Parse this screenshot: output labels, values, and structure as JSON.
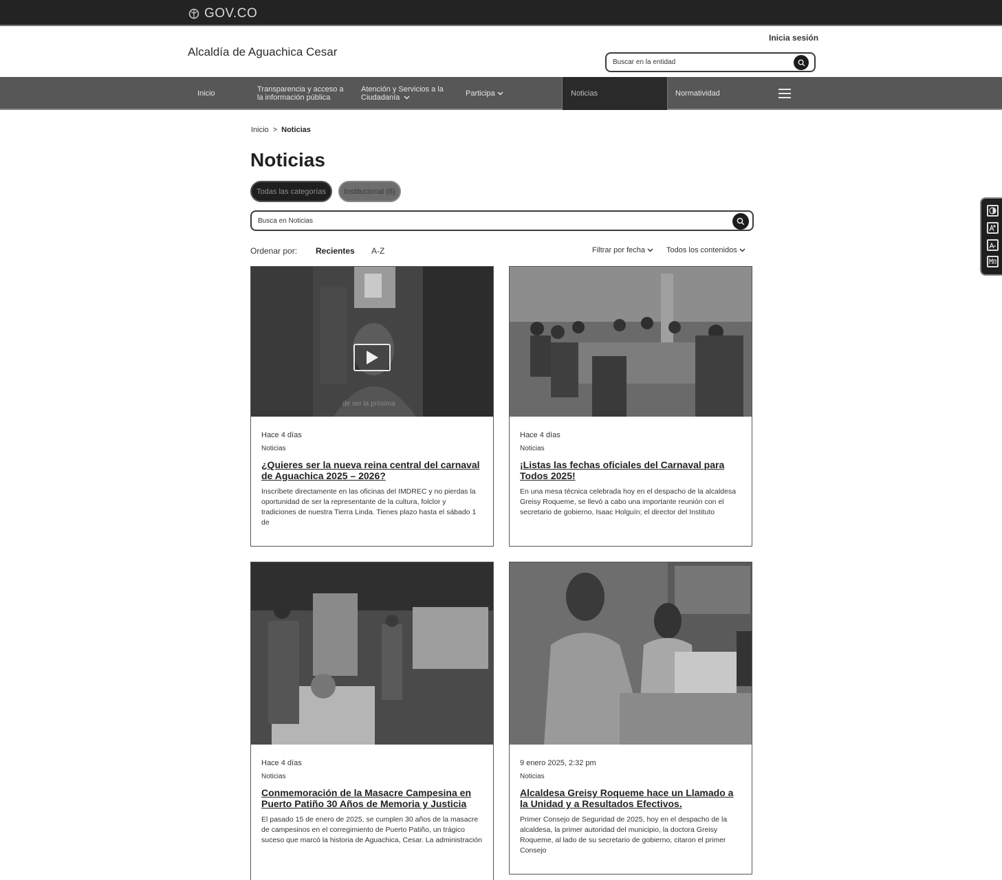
{
  "govbar": {
    "logo_text": "GOV.CO"
  },
  "header": {
    "entity_title": "Alcaldía de Aguachica Cesar",
    "login_label": "Inicia sesión",
    "search_placeholder": "Buscar en la entidad"
  },
  "nav": {
    "items": [
      {
        "label": "Inicio"
      },
      {
        "label": "Transparencia y acceso a la información pública"
      },
      {
        "label": "Atención y Servicios a la Ciudadanía"
      },
      {
        "label": "Participa"
      },
      {
        "label": "Noticias",
        "active": true
      },
      {
        "label": "Normatividad"
      }
    ]
  },
  "breadcrumb": {
    "home": "Inicio",
    "separator": ">",
    "current": "Noticias"
  },
  "page_title": "Noticias",
  "filters": {
    "chips": [
      {
        "label": "Todas las categorías"
      },
      {
        "label": "Institucional (6)"
      }
    ],
    "search_placeholder": "Busca en Noticias",
    "sort_label": "Ordenar por:",
    "sort_options": [
      "Recientes",
      "A-Z"
    ],
    "date_filter": "Filtrar por fecha",
    "content_filter": "Todos los contenidos"
  },
  "cards": [
    {
      "date": "Hace 4 días",
      "category": "Noticias",
      "title": "¿Quieres ser la nueva reina central del carnaval de Aguachica 2025 – 2026?",
      "excerpt": "Inscríbete directamente en las oficinas del IMDREC y no pierdas la oportunidad de ser la representante de la cultura, folclor y tradiciones de nuestra Tierra Linda. Tienes plazo hasta el sábado 1 de",
      "image_overlay_text": "de ser la próxima",
      "has_video": true
    },
    {
      "date": "Hace 4 días",
      "category": "Noticias",
      "title": "¡Listas las fechas oficiales del Carnaval para Todos 2025!",
      "excerpt": "En una mesa técnica celebrada hoy en el despacho de la alcaldesa Greisy Roqueme, se llevó a cabo una importante reunión con el secretario de gobierno, Isaac Holguín; el director del Instituto"
    },
    {
      "date": "Hace 4 días",
      "category": "Noticias",
      "title": "Conmemoración de la Masacre Campesina en Puerto Patiño 30 Años de Memoria y Justicia",
      "excerpt": "El pasado 15 de enero de 2025, se cumplen 30 años de la masacre de campesinos en el corregimiento de Puerto Patiño, un trágico suceso que marcó la historia de Aguachica, Cesar. La administración"
    },
    {
      "date": "9 enero 2025, 2:32 pm",
      "category": "Noticias",
      "title": "Alcaldesa Greisy Roqueme hace un Llamado a la Unidad y a Resultados Efectivos.",
      "excerpt": "Primer Consejo de Seguridad de 2025, hoy en el despacho de la alcaldesa, la primer autoridad del municipio, la doctora Greisy Roqueme, al lado de su secretario de gobierno, citaron el primer Consejo"
    }
  ],
  "accessibility": {
    "tools": [
      "contrast-icon",
      "increase-text-icon",
      "decrease-text-icon",
      "sign-language-icon"
    ]
  }
}
